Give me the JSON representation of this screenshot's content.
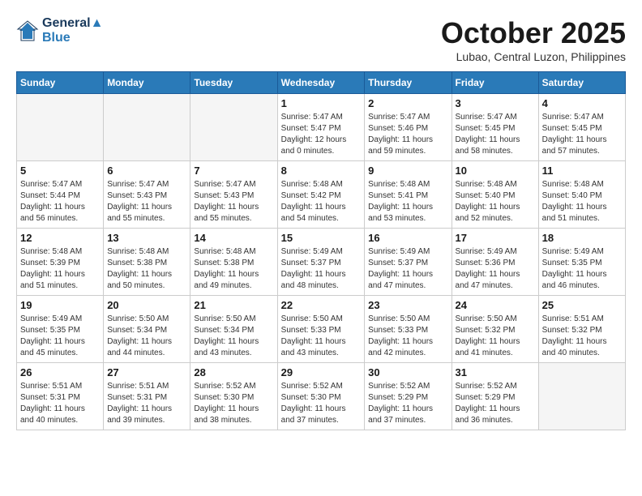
{
  "header": {
    "logo_line1": "General",
    "logo_line2": "Blue",
    "month": "October 2025",
    "location": "Lubao, Central Luzon, Philippines"
  },
  "weekdays": [
    "Sunday",
    "Monday",
    "Tuesday",
    "Wednesday",
    "Thursday",
    "Friday",
    "Saturday"
  ],
  "weeks": [
    [
      {
        "day": "",
        "sunrise": "",
        "sunset": "",
        "daylight": ""
      },
      {
        "day": "",
        "sunrise": "",
        "sunset": "",
        "daylight": ""
      },
      {
        "day": "",
        "sunrise": "",
        "sunset": "",
        "daylight": ""
      },
      {
        "day": "1",
        "sunrise": "Sunrise: 5:47 AM",
        "sunset": "Sunset: 5:47 PM",
        "daylight": "Daylight: 12 hours and 0 minutes."
      },
      {
        "day": "2",
        "sunrise": "Sunrise: 5:47 AM",
        "sunset": "Sunset: 5:46 PM",
        "daylight": "Daylight: 11 hours and 59 minutes."
      },
      {
        "day": "3",
        "sunrise": "Sunrise: 5:47 AM",
        "sunset": "Sunset: 5:45 PM",
        "daylight": "Daylight: 11 hours and 58 minutes."
      },
      {
        "day": "4",
        "sunrise": "Sunrise: 5:47 AM",
        "sunset": "Sunset: 5:45 PM",
        "daylight": "Daylight: 11 hours and 57 minutes."
      }
    ],
    [
      {
        "day": "5",
        "sunrise": "Sunrise: 5:47 AM",
        "sunset": "Sunset: 5:44 PM",
        "daylight": "Daylight: 11 hours and 56 minutes."
      },
      {
        "day": "6",
        "sunrise": "Sunrise: 5:47 AM",
        "sunset": "Sunset: 5:43 PM",
        "daylight": "Daylight: 11 hours and 55 minutes."
      },
      {
        "day": "7",
        "sunrise": "Sunrise: 5:47 AM",
        "sunset": "Sunset: 5:43 PM",
        "daylight": "Daylight: 11 hours and 55 minutes."
      },
      {
        "day": "8",
        "sunrise": "Sunrise: 5:48 AM",
        "sunset": "Sunset: 5:42 PM",
        "daylight": "Daylight: 11 hours and 54 minutes."
      },
      {
        "day": "9",
        "sunrise": "Sunrise: 5:48 AM",
        "sunset": "Sunset: 5:41 PM",
        "daylight": "Daylight: 11 hours and 53 minutes."
      },
      {
        "day": "10",
        "sunrise": "Sunrise: 5:48 AM",
        "sunset": "Sunset: 5:40 PM",
        "daylight": "Daylight: 11 hours and 52 minutes."
      },
      {
        "day": "11",
        "sunrise": "Sunrise: 5:48 AM",
        "sunset": "Sunset: 5:40 PM",
        "daylight": "Daylight: 11 hours and 51 minutes."
      }
    ],
    [
      {
        "day": "12",
        "sunrise": "Sunrise: 5:48 AM",
        "sunset": "Sunset: 5:39 PM",
        "daylight": "Daylight: 11 hours and 51 minutes."
      },
      {
        "day": "13",
        "sunrise": "Sunrise: 5:48 AM",
        "sunset": "Sunset: 5:38 PM",
        "daylight": "Daylight: 11 hours and 50 minutes."
      },
      {
        "day": "14",
        "sunrise": "Sunrise: 5:48 AM",
        "sunset": "Sunset: 5:38 PM",
        "daylight": "Daylight: 11 hours and 49 minutes."
      },
      {
        "day": "15",
        "sunrise": "Sunrise: 5:49 AM",
        "sunset": "Sunset: 5:37 PM",
        "daylight": "Daylight: 11 hours and 48 minutes."
      },
      {
        "day": "16",
        "sunrise": "Sunrise: 5:49 AM",
        "sunset": "Sunset: 5:37 PM",
        "daylight": "Daylight: 11 hours and 47 minutes."
      },
      {
        "day": "17",
        "sunrise": "Sunrise: 5:49 AM",
        "sunset": "Sunset: 5:36 PM",
        "daylight": "Daylight: 11 hours and 47 minutes."
      },
      {
        "day": "18",
        "sunrise": "Sunrise: 5:49 AM",
        "sunset": "Sunset: 5:35 PM",
        "daylight": "Daylight: 11 hours and 46 minutes."
      }
    ],
    [
      {
        "day": "19",
        "sunrise": "Sunrise: 5:49 AM",
        "sunset": "Sunset: 5:35 PM",
        "daylight": "Daylight: 11 hours and 45 minutes."
      },
      {
        "day": "20",
        "sunrise": "Sunrise: 5:50 AM",
        "sunset": "Sunset: 5:34 PM",
        "daylight": "Daylight: 11 hours and 44 minutes."
      },
      {
        "day": "21",
        "sunrise": "Sunrise: 5:50 AM",
        "sunset": "Sunset: 5:34 PM",
        "daylight": "Daylight: 11 hours and 43 minutes."
      },
      {
        "day": "22",
        "sunrise": "Sunrise: 5:50 AM",
        "sunset": "Sunset: 5:33 PM",
        "daylight": "Daylight: 11 hours and 43 minutes."
      },
      {
        "day": "23",
        "sunrise": "Sunrise: 5:50 AM",
        "sunset": "Sunset: 5:33 PM",
        "daylight": "Daylight: 11 hours and 42 minutes."
      },
      {
        "day": "24",
        "sunrise": "Sunrise: 5:50 AM",
        "sunset": "Sunset: 5:32 PM",
        "daylight": "Daylight: 11 hours and 41 minutes."
      },
      {
        "day": "25",
        "sunrise": "Sunrise: 5:51 AM",
        "sunset": "Sunset: 5:32 PM",
        "daylight": "Daylight: 11 hours and 40 minutes."
      }
    ],
    [
      {
        "day": "26",
        "sunrise": "Sunrise: 5:51 AM",
        "sunset": "Sunset: 5:31 PM",
        "daylight": "Daylight: 11 hours and 40 minutes."
      },
      {
        "day": "27",
        "sunrise": "Sunrise: 5:51 AM",
        "sunset": "Sunset: 5:31 PM",
        "daylight": "Daylight: 11 hours and 39 minutes."
      },
      {
        "day": "28",
        "sunrise": "Sunrise: 5:52 AM",
        "sunset": "Sunset: 5:30 PM",
        "daylight": "Daylight: 11 hours and 38 minutes."
      },
      {
        "day": "29",
        "sunrise": "Sunrise: 5:52 AM",
        "sunset": "Sunset: 5:30 PM",
        "daylight": "Daylight: 11 hours and 37 minutes."
      },
      {
        "day": "30",
        "sunrise": "Sunrise: 5:52 AM",
        "sunset": "Sunset: 5:29 PM",
        "daylight": "Daylight: 11 hours and 37 minutes."
      },
      {
        "day": "31",
        "sunrise": "Sunrise: 5:52 AM",
        "sunset": "Sunset: 5:29 PM",
        "daylight": "Daylight: 11 hours and 36 minutes."
      },
      {
        "day": "",
        "sunrise": "",
        "sunset": "",
        "daylight": ""
      }
    ]
  ]
}
